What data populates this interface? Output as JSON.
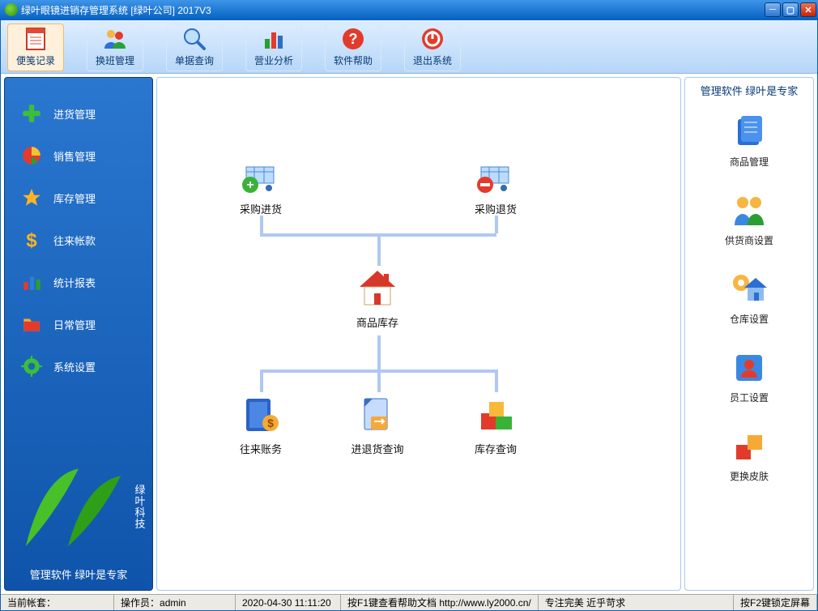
{
  "title": "绿叶眼镜进销存管理系统 [绿叶公司] 2017V3",
  "toolbar": [
    {
      "id": "memo",
      "label": "便笺记录"
    },
    {
      "id": "shift",
      "label": "换班管理"
    },
    {
      "id": "billquery",
      "label": "单据查询"
    },
    {
      "id": "analysis",
      "label": "营业分析"
    },
    {
      "id": "help",
      "label": "软件帮助"
    },
    {
      "id": "exit",
      "label": "退出系统"
    }
  ],
  "sidebar": {
    "items": [
      {
        "id": "purchase",
        "label": "进货管理"
      },
      {
        "id": "sales",
        "label": "销售管理"
      },
      {
        "id": "stock",
        "label": "库存管理"
      },
      {
        "id": "account",
        "label": "往来帐款"
      },
      {
        "id": "report",
        "label": "统计报表"
      },
      {
        "id": "daily",
        "label": "日常管理"
      },
      {
        "id": "settings",
        "label": "系统设置"
      }
    ],
    "brand_line1": "绿叶",
    "brand_line2": "科技",
    "slogan": "管理软件 绿叶是专家"
  },
  "diagram": {
    "nodes": {
      "in": "采购进货",
      "ret": "采购退货",
      "stock": "商品库存",
      "acct": "往来账务",
      "inout": "进退货查询",
      "stockq": "库存查询"
    }
  },
  "rightpanel": {
    "title": "管理软件 绿叶是专家",
    "items": [
      {
        "id": "goods",
        "label": "商品管理"
      },
      {
        "id": "supplier",
        "label": "供货商设置"
      },
      {
        "id": "warehouse",
        "label": "仓库设置"
      },
      {
        "id": "employee",
        "label": "员工设置"
      },
      {
        "id": "skin",
        "label": "更换皮肤"
      }
    ]
  },
  "status": {
    "accountset": "当前帐套：",
    "operator_label": "操作员：",
    "operator": "admin",
    "datetime": "2020-04-30 11:11:20",
    "helptip": "按F1键查看帮助文档",
    "url": "http://www.ly2000.cn/",
    "motto": "专注完美 近乎苛求",
    "locktip": "按F2键锁定屏幕"
  }
}
